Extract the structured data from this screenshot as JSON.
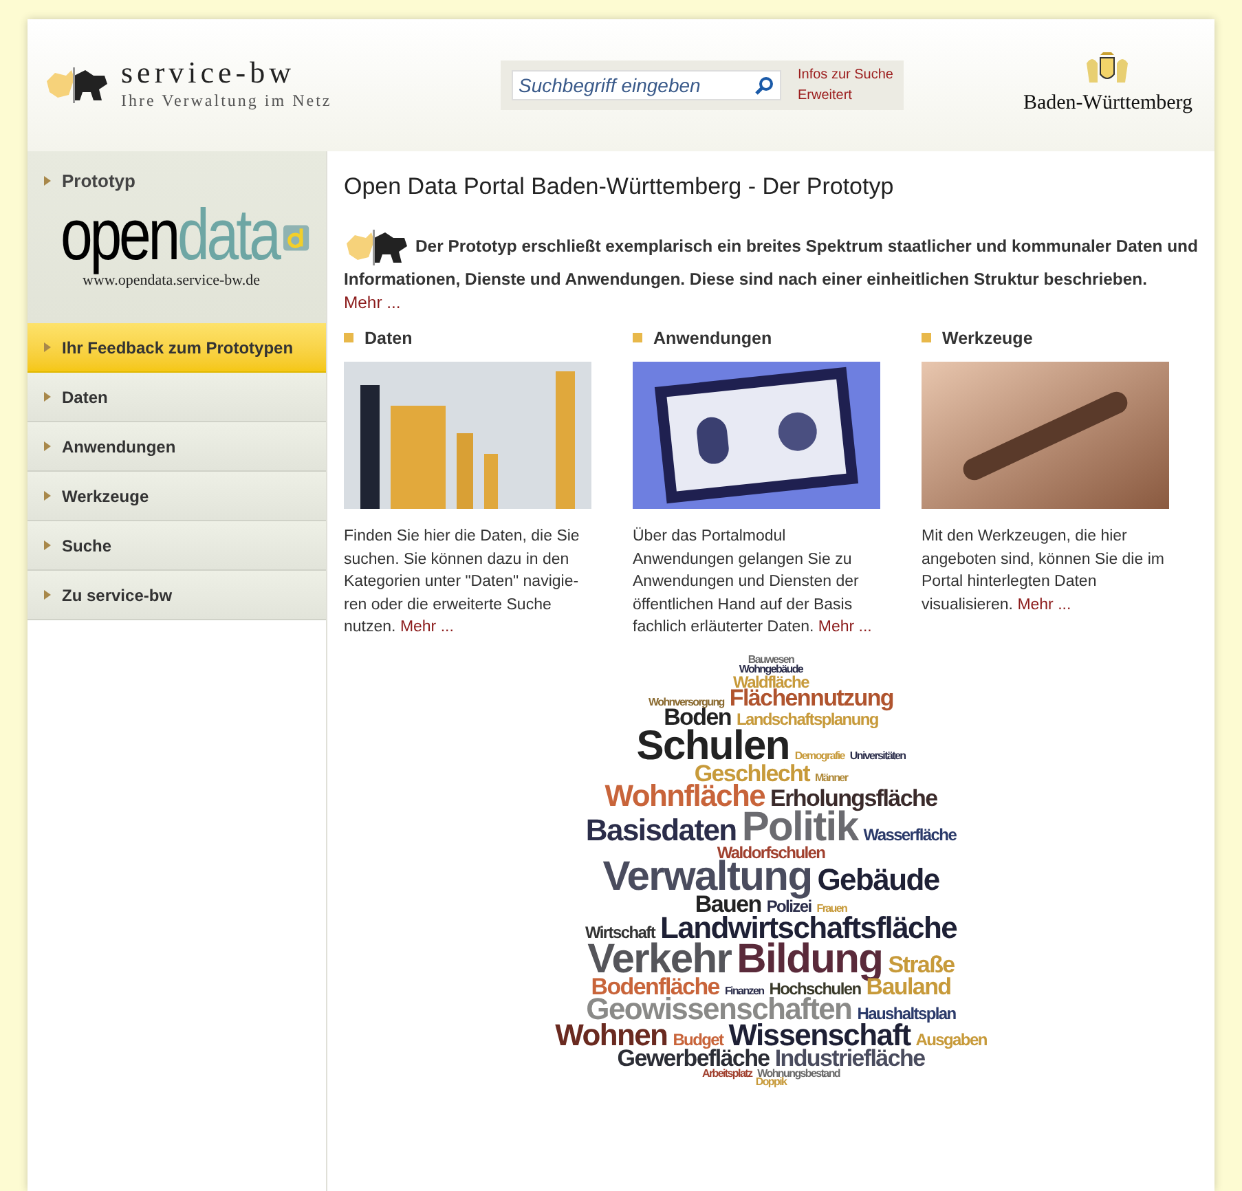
{
  "header": {
    "brand": {
      "name": "service-bw",
      "tagline": "Ihre Verwaltung im Netz"
    },
    "search": {
      "placeholder": "Suchbegriff eingeben"
    },
    "search_links": [
      "Infos zur Suche",
      "Erweitert"
    ],
    "state_name": "Baden-Württemberg"
  },
  "sidebar": {
    "heading": "Prototyp",
    "logo": {
      "open": "open",
      "data": "data",
      "url": "www.opendata.service-bw.de"
    },
    "items": [
      {
        "label": "Ihr Feedback zum Prototypen",
        "selected": true
      },
      {
        "label": "Daten",
        "selected": false
      },
      {
        "label": "Anwendungen",
        "selected": false
      },
      {
        "label": "Werkzeuge",
        "selected": false
      },
      {
        "label": "Suche",
        "selected": false
      },
      {
        "label": "Zu service-bw",
        "selected": false
      }
    ]
  },
  "main": {
    "title": "Open Data Portal Baden-Württemberg - Der Prototyp",
    "intro": "Der Prototyp erschließt exemplarisch ein breites Spektrum staatlicher und kommunaler Daten und Informationen, Dienste und Anwendungen. Diese sind nach einer einheitlichen Struktur beschrieben.",
    "intro_link": "Mehr ...",
    "sections": [
      {
        "heading": "Daten",
        "kind": "office",
        "text": "Finden Sie hier die Daten, die Sie suchen. Sie können dazu in den Kategorien unter \"Daten\" navigie-ren oder die erweiterte Suche nutzen.",
        "link": "Mehr ..."
      },
      {
        "heading": "Anwendungen",
        "kind": "monitor",
        "text": "Über das Portalmodul Anwendungen gelangen Sie zu Anwendungen und Diensten der öffentlichen Hand auf der Basis fachlich erläuterter Daten.",
        "link": "Mehr ..."
      },
      {
        "heading": "Werkzeuge",
        "kind": "tools",
        "text": "Mit den Werkzeugen, die hier angeboten sind, können Sie die im Portal hinterlegten Daten visualisieren.",
        "link": "Mehr ..."
      }
    ],
    "word_cloud": [
      [
        {
          "word": "Bauwesen",
          "kind": "tiny",
          "color": "#6b6b6b"
        }
      ],
      [
        {
          "word": "Wohngebäude",
          "kind": "tiny",
          "color": "#2b2d4a"
        }
      ],
      [
        {
          "word": "Waldfläche",
          "kind": "small",
          "color": "#c79a3a"
        }
      ],
      [
        {
          "word": "Wohnversorgung",
          "kind": "tiny",
          "color": "#8a6a30"
        },
        {
          "word": "Flächennutzung",
          "kind": "medium",
          "color": "#b0542e"
        }
      ],
      [
        {
          "word": "Boden",
          "kind": "medium",
          "color": "#222222"
        },
        {
          "word": "Landschaftsplanung",
          "kind": "small",
          "color": "#c79a3a"
        }
      ],
      [
        {
          "word": "Schulen",
          "kind": "huge",
          "color": "#222222"
        },
        {
          "word": "Demografie",
          "kind": "tiny",
          "color": "#c79a3a"
        },
        {
          "word": "Universitäten",
          "kind": "tiny",
          "color": "#2b2d4a"
        }
      ],
      [
        {
          "word": "Geschlecht",
          "kind": "medium",
          "color": "#c79a3a"
        },
        {
          "word": "Männer",
          "kind": "tiny",
          "color": "#b08a3a"
        }
      ],
      [
        {
          "word": "Wohnfläche",
          "kind": "large",
          "color": "#c8643a"
        },
        {
          "word": "Erholungsfläche",
          "kind": "medium",
          "color": "#3a2a2a"
        }
      ],
      [
        {
          "word": "Basisdaten",
          "kind": "large",
          "color": "#2b2d4a"
        },
        {
          "word": "Politik",
          "kind": "huge",
          "color": "#6b6b70"
        },
        {
          "word": "Wasserfläche",
          "kind": "small",
          "color": "#2b3a6a"
        }
      ],
      [
        {
          "word": "Waldorfschulen",
          "kind": "small",
          "color": "#a0402e"
        }
      ],
      [
        {
          "word": "Verwaltung",
          "kind": "huge",
          "color": "#4a4c5e"
        },
        {
          "word": "Gebäude",
          "kind": "large",
          "color": "#1e2035"
        }
      ],
      [
        {
          "word": "Bauen",
          "kind": "medium",
          "color": "#222222"
        },
        {
          "word": "Polizei",
          "kind": "small",
          "color": "#2b2d4a"
        },
        {
          "word": "Frauen",
          "kind": "tiny",
          "color": "#c79a3a"
        }
      ],
      [
        {
          "word": "Wirtschaft",
          "kind": "small",
          "color": "#333333"
        },
        {
          "word": "Landwirtschaftsfläche",
          "kind": "large",
          "color": "#1e2035"
        }
      ],
      [
        {
          "word": "Verkehr",
          "kind": "huge",
          "color": "#55555a"
        },
        {
          "word": "Bildung",
          "kind": "huge",
          "color": "#5a2a3a"
        },
        {
          "word": "Straße",
          "kind": "medium",
          "color": "#c79a3a"
        }
      ],
      [
        {
          "word": "Bodenfläche",
          "kind": "medium",
          "color": "#c8643a"
        },
        {
          "word": "Finanzen",
          "kind": "tiny",
          "color": "#2b2d4a"
        },
        {
          "word": "Hochschulen",
          "kind": "small",
          "color": "#3a3a2a"
        },
        {
          "word": "Bauland",
          "kind": "medium",
          "color": "#c79a3a"
        }
      ],
      [
        {
          "word": "Geowissenschaften",
          "kind": "large",
          "color": "#8a8a88"
        },
        {
          "word": "Haushaltsplan",
          "kind": "small",
          "color": "#2b3a6a"
        }
      ],
      [
        {
          "word": "Wohnen",
          "kind": "large",
          "color": "#6a2a20"
        },
        {
          "word": "Budget",
          "kind": "small",
          "color": "#c8643a"
        },
        {
          "word": "Wissenschaft",
          "kind": "large",
          "color": "#1e2035"
        },
        {
          "word": "Ausgaben",
          "kind": "small",
          "color": "#c79a3a"
        }
      ],
      [
        {
          "word": "Gewerbefläche",
          "kind": "medium",
          "color": "#2b2d35"
        },
        {
          "word": "Industriefläche",
          "kind": "medium",
          "color": "#4a4c5e"
        }
      ],
      [
        {
          "word": "Arbeitsplatz",
          "kind": "tiny",
          "color": "#a0402e"
        },
        {
          "word": "Wohnungsbestand",
          "kind": "tiny",
          "color": "#6b6b6b"
        }
      ],
      [
        {
          "word": "Doppik",
          "kind": "tiny",
          "color": "#c79a3a"
        }
      ]
    ]
  }
}
